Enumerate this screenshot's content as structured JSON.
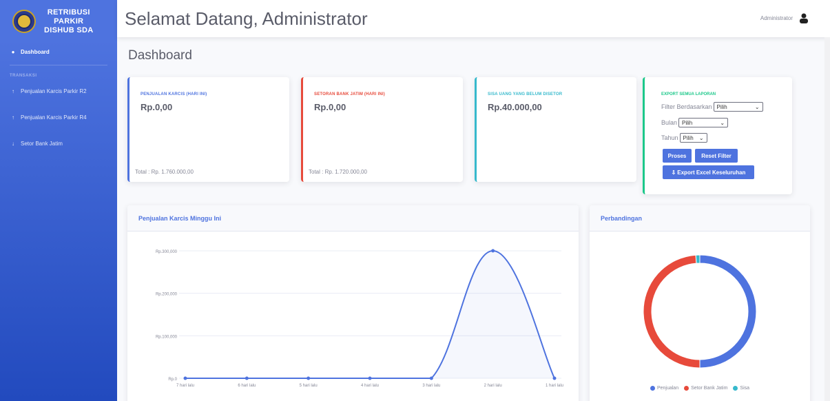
{
  "brand": {
    "lines": [
      "RETRIBUSI",
      "PARKIR",
      "DISHUB SDA"
    ],
    "logo_icon": "dishub-emblem-logo"
  },
  "sidebar": {
    "dashboard": {
      "label": "Dashboard",
      "icon": "tachometer-icon"
    },
    "heading": "TRANSAKSI",
    "items": [
      {
        "label": "Penjualan Karcis Parkir R2",
        "icon": "arrow-up-icon"
      },
      {
        "label": "Penjualan Karcis Parkir R4",
        "icon": "arrow-up-icon"
      },
      {
        "label": "Setor Bank Jatim",
        "icon": "arrow-down-icon"
      }
    ]
  },
  "topbar": {
    "welcome": "Selamat Datang, Administrator",
    "user_name": "Administrator",
    "user_icon": "user-icon"
  },
  "page": {
    "title": "Dashboard"
  },
  "cards": [
    {
      "label": "PENJUALAN KARCIS (HARI INI)",
      "value": "Rp.0,00",
      "total": "Total : Rp. 1.760.000,00",
      "color": "#4e73df"
    },
    {
      "label": "SETORAN BANK JATIM (HARI INI)",
      "value": "Rp.0,00",
      "total": "Total : Rp. 1.720.000,00",
      "color": "#e74a3b"
    },
    {
      "label": "SISA UANG YANG BELUM DISETOR",
      "value": "Rp.40.000,00",
      "total": "",
      "color": "#36b9cc"
    }
  ],
  "export": {
    "label": "EXPORT SEMUA LAPORAN",
    "filter_label": "Filter Berdasarkan",
    "filter_value": "Pilih",
    "bulan_label": "Bulan",
    "bulan_value": "Pilih",
    "tahun_label": "Tahun",
    "tahun_value": "Pilih",
    "btn_proses": "Proses",
    "btn_reset": "Reset Filter",
    "btn_export": "Export Excel Keseluruhan",
    "accent": "#1cc88a"
  },
  "line_card": {
    "title": "Penjualan Karcis Minggu Ini"
  },
  "donut_card": {
    "title": "Perbandingan"
  },
  "chart_data": [
    {
      "type": "area",
      "title": "Penjualan Karcis Minggu Ini",
      "categories": [
        "7 hari lalu",
        "6 hari lalu",
        "5 hari lalu",
        "4 hari lalu",
        "3 hari lalu",
        "2 hari lalu",
        "1 hari lalu"
      ],
      "values": [
        0,
        0,
        0,
        0,
        0,
        300000,
        0
      ],
      "y_ticks": [
        "Rp.0",
        "Rp.100,000",
        "Rp.200,000",
        "Rp.300,000"
      ],
      "ylim": [
        0,
        300000
      ],
      "color": "#4e73df",
      "grid": true
    },
    {
      "type": "pie",
      "title": "Perbandingan",
      "labels": [
        "Penjualan",
        "Setor Bank Jatim",
        "Sisa"
      ],
      "values": [
        1760000,
        1720000,
        40000
      ],
      "colors": [
        "#4e73df",
        "#e74a3b",
        "#36b9cc"
      ],
      "legend": "bottom"
    }
  ]
}
